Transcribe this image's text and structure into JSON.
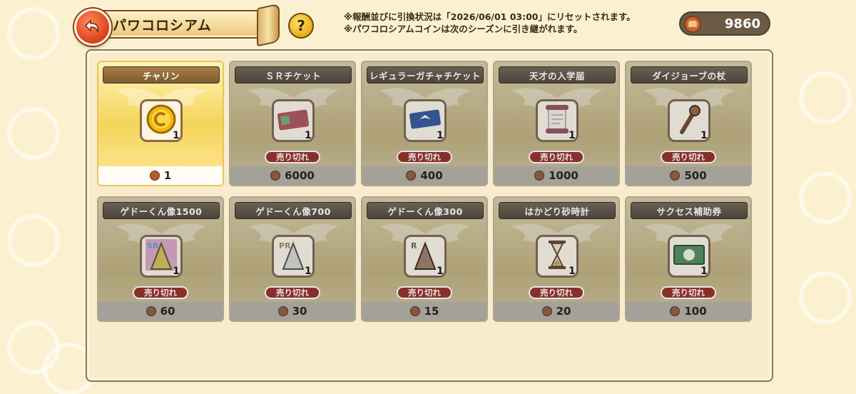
{
  "header": {
    "title": "パワコロシアム",
    "help_label": "?",
    "notice_line1": "※報酬並びに引換状況は「2026/06/01 03:00」にリセットされます。",
    "notice_line2": "※パワコロシアムコインは次のシーズンに引き継がれます。",
    "coin_balance": "9860"
  },
  "colors": {
    "accent": "#d9231b",
    "panel": "#f9eccd",
    "gold": "#f4d55a"
  },
  "shop": {
    "sold_out_label": "売り切れ",
    "items": [
      {
        "name": "チャリン",
        "qty": "1",
        "price": "1",
        "icon": "coin-icon",
        "sold_out": false
      },
      {
        "name": "ＳＲチケット",
        "qty": "1",
        "price": "6000",
        "icon": "sr-ticket-icon",
        "sold_out": true
      },
      {
        "name": "レギュラーガチャチケット",
        "qty": "1",
        "price": "400",
        "icon": "gacha-ticket-icon",
        "sold_out": true
      },
      {
        "name": "天才の入学届",
        "qty": "1",
        "price": "1000",
        "icon": "scroll-icon",
        "sold_out": true
      },
      {
        "name": "ダイジョーブの杖",
        "qty": "1",
        "price": "500",
        "icon": "staff-icon",
        "sold_out": true
      },
      {
        "name": "ゲドーくん像1500",
        "qty": "1",
        "price": "60",
        "icon": "statue-sr-icon",
        "sold_out": true
      },
      {
        "name": "ゲドーくん像700",
        "qty": "1",
        "price": "30",
        "icon": "statue-pr-icon",
        "sold_out": true
      },
      {
        "name": "ゲドーくん像300",
        "qty": "1",
        "price": "15",
        "icon": "statue-r-icon",
        "sold_out": true
      },
      {
        "name": "はかどり砂時計",
        "qty": "1",
        "price": "20",
        "icon": "hourglass-icon",
        "sold_out": true
      },
      {
        "name": "サクセス補助券",
        "qty": "1",
        "price": "100",
        "icon": "voucher-icon",
        "sold_out": true
      }
    ]
  }
}
